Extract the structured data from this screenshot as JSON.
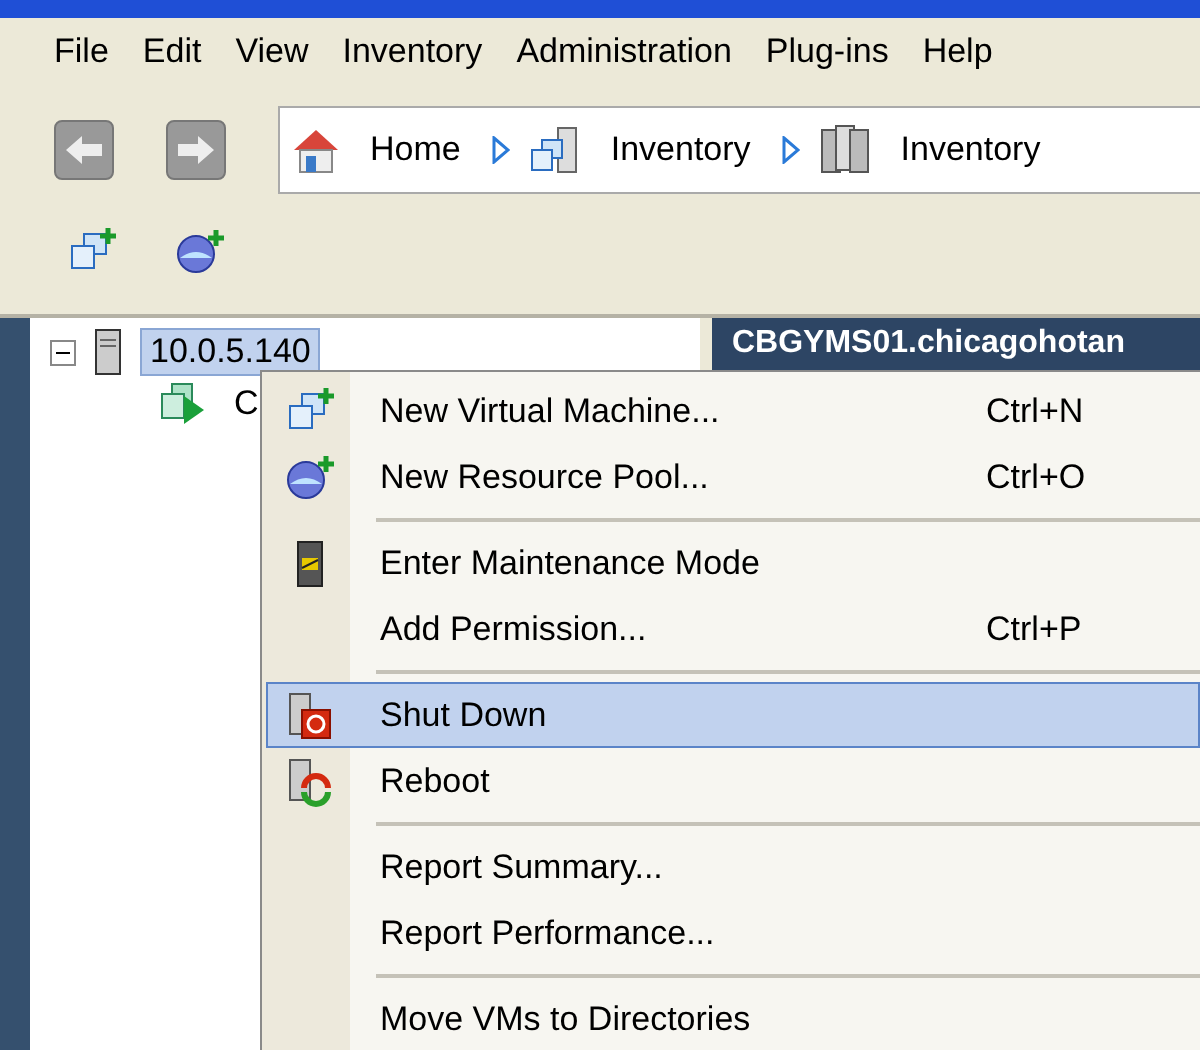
{
  "menu_bar": [
    "File",
    "Edit",
    "View",
    "Inventory",
    "Administration",
    "Plug-ins",
    "Help"
  ],
  "navigation": {
    "breadcrumbs": [
      {
        "label": "Home",
        "kind": "home"
      },
      {
        "label": "Inventory",
        "kind": "vms"
      },
      {
        "label": "Inventory",
        "kind": "hosts"
      }
    ]
  },
  "toolbar": [
    {
      "kind": "new-vm"
    },
    {
      "kind": "new-pool"
    }
  ],
  "tree": [
    {
      "label": "10.0.5.140",
      "kind": "host",
      "expanded": true,
      "selected": true,
      "children": [
        {
          "label": "C",
          "kind": "cluster",
          "selected": false
        }
      ]
    }
  ],
  "detail_header": {
    "title": "CBGYMS01.chicagohotan"
  },
  "context_menu": [
    {
      "kind": "vm",
      "label": "New Virtual Machine...",
      "shortcut": "Ctrl+N",
      "selected": false
    },
    {
      "kind": "pool",
      "label": "New Resource Pool...",
      "shortcut": "Ctrl+O",
      "selected": false
    },
    {
      "kind": "separator"
    },
    {
      "kind": "maintenance",
      "label": "Enter Maintenance Mode",
      "selected": false
    },
    {
      "kind": "plain",
      "label": "Add Permission...",
      "shortcut": "Ctrl+P",
      "selected": false
    },
    {
      "kind": "separator"
    },
    {
      "kind": "shutdown",
      "label": "Shut Down",
      "selected": true
    },
    {
      "kind": "reboot",
      "label": "Reboot",
      "selected": false
    },
    {
      "kind": "separator"
    },
    {
      "kind": "plain",
      "label": "Report Summary...",
      "selected": false
    },
    {
      "kind": "plain",
      "label": "Report Performance...",
      "selected": false
    },
    {
      "kind": "separator"
    },
    {
      "kind": "plain",
      "label": "Move VMs to Directories",
      "selected": false
    }
  ]
}
